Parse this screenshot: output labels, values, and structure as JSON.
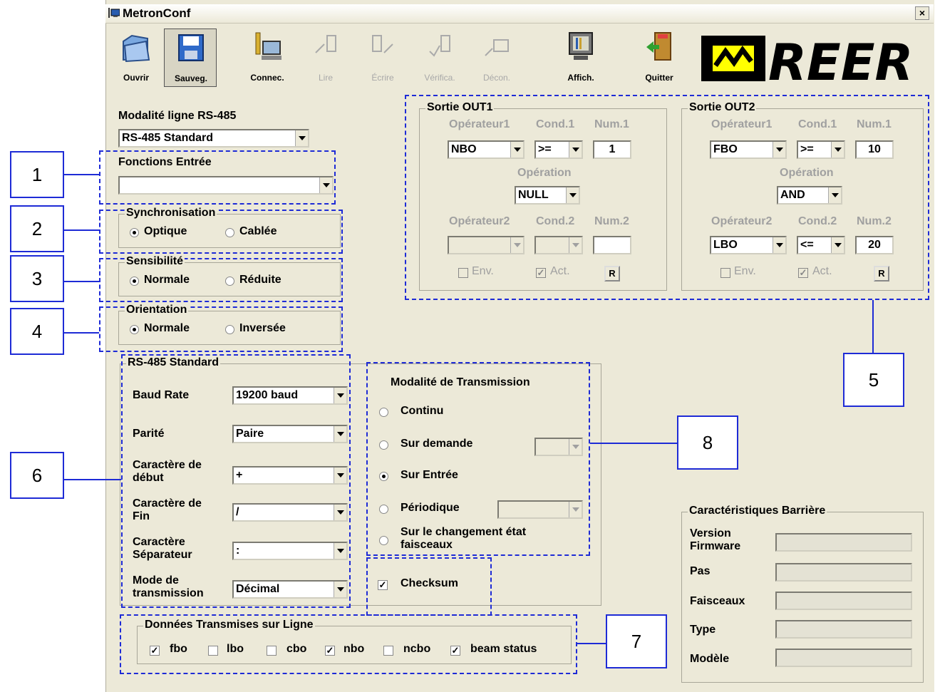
{
  "window": {
    "title": "MetronConf",
    "close": "×"
  },
  "toolbar": [
    {
      "label": "Ouvrir",
      "enabled": true
    },
    {
      "label": "Sauveg.",
      "enabled": true,
      "selected": true
    },
    {
      "label": "Connec.",
      "enabled": true
    },
    {
      "label": "Lire",
      "enabled": false
    },
    {
      "label": "Écrire",
      "enabled": false
    },
    {
      "label": "Vérifica.",
      "enabled": false
    },
    {
      "label": "Décon.",
      "enabled": false
    },
    {
      "label": "Affich.",
      "enabled": true
    },
    {
      "label": "Quitter",
      "enabled": true
    }
  ],
  "logo": {
    "text": "REER",
    "color": "#000000",
    "accent": "#ffff00"
  },
  "rs485_mode": {
    "label": "Modalité ligne RS-485",
    "value": "RS-485 Standard"
  },
  "input_functions": {
    "label": "Fonctions Entrée",
    "value": ""
  },
  "synchronisation": {
    "title": "Synchronisation",
    "options": [
      "Optique",
      "Cablée"
    ],
    "selected": "Optique"
  },
  "sensibilite": {
    "title": "Sensibilité",
    "options": [
      "Normale",
      "Réduite"
    ],
    "selected": "Normale"
  },
  "orientation": {
    "title": "Orientation",
    "options": [
      "Normale",
      "Inversée"
    ],
    "selected": "Normale"
  },
  "out1": {
    "title": "Sortie OUT1",
    "op1_label": "Opérateur1",
    "cond1_label": "Cond.1",
    "num1_label": "Num.1",
    "op1": "NBO",
    "cond1": ">=",
    "num1": "1",
    "operation_label": "Opération",
    "operation": "NULL",
    "op2_label": "Opérateur2",
    "cond2_label": "Cond.2",
    "num2_label": "Num.2",
    "op2": "",
    "cond2": "",
    "num2": "",
    "env_label": "Env.",
    "act_label": "Act.",
    "r_label": "R"
  },
  "out2": {
    "title": "Sortie OUT2",
    "op1_label": "Opérateur1",
    "cond1_label": "Cond.1",
    "num1_label": "Num.1",
    "op1": "FBO",
    "cond1": ">=",
    "num1": "10",
    "operation_label": "Opération",
    "operation": "AND",
    "op2_label": "Opérateur2",
    "cond2_label": "Cond.2",
    "num2_label": "Num.2",
    "op2": "LBO",
    "cond2": "<=",
    "num2": "20",
    "env_label": "Env.",
    "act_label": "Act.",
    "r_label": "R"
  },
  "rs485_standard": {
    "title": "RS-485 Standard",
    "baud_label": "Baud Rate",
    "baud": "19200 baud",
    "parity_label": "Parité",
    "parity": "Paire",
    "start_label_1": "Caractère de",
    "start_label_2": "début",
    "start": "+",
    "end_label_1": "Caractère de",
    "end_label_2": "Fin",
    "end": "/",
    "sep_label_1": "Caractère",
    "sep_label_2": "Séparateur",
    "sep": ":",
    "mode_label_1": "Mode de",
    "mode_label_2": "transmission",
    "mode": "Décimal"
  },
  "transmission": {
    "title": "Modalité de Transmission",
    "continu": "Continu",
    "sur_demande": "Sur demande",
    "sur_entree": "Sur Entrée",
    "periodique": "Périodique",
    "changement_1": "Sur le changement état",
    "changement_2": "faisceaux",
    "selected": "Sur Entrée"
  },
  "checksum": {
    "label": "Checksum",
    "checked": true
  },
  "donnees": {
    "title": "Données Transmises sur Ligne",
    "items": [
      {
        "label": "fbo",
        "checked": true
      },
      {
        "label": "lbo",
        "checked": false
      },
      {
        "label": "cbo",
        "checked": false
      },
      {
        "label": "nbo",
        "checked": true
      },
      {
        "label": "ncbo",
        "checked": false
      },
      {
        "label": "beam status",
        "checked": true
      }
    ]
  },
  "barriere": {
    "title": "Caractéristiques Barrière",
    "version_1": "Version",
    "version_2": "Firmware",
    "pas": "Pas",
    "faisceaux": "Faisceaux",
    "type": "Type",
    "modele": "Modèle"
  },
  "callouts": [
    "1",
    "2",
    "3",
    "4",
    "5",
    "6",
    "7",
    "8"
  ],
  "colors": {
    "annotation": "#1e2bd6",
    "window": "#ece9d8"
  }
}
